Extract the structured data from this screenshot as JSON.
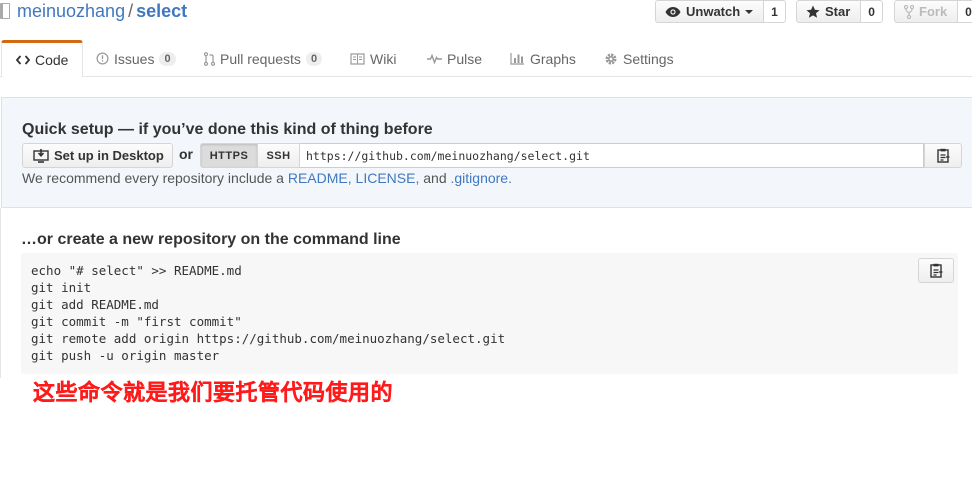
{
  "repo": {
    "owner": "meinuozhang",
    "separator": "/",
    "name": "select"
  },
  "actions": {
    "watch": {
      "label": "Unwatch",
      "count": "1"
    },
    "star": {
      "label": "Star",
      "count": "0"
    },
    "fork": {
      "label": "Fork",
      "count": "0"
    }
  },
  "tabs": [
    {
      "label": "Code",
      "icon": "code-icon",
      "selected": true
    },
    {
      "label": "Issues",
      "count": "0",
      "icon": "issue-icon"
    },
    {
      "label": "Pull requests",
      "count": "0",
      "icon": "pull-request-icon"
    },
    {
      "label": "Wiki",
      "icon": "book-icon"
    },
    {
      "label": "Pulse",
      "icon": "pulse-icon"
    },
    {
      "label": "Graphs",
      "icon": "graph-icon"
    },
    {
      "label": "Settings",
      "icon": "gear-icon"
    }
  ],
  "quick_setup": {
    "title": "Quick setup — if you’ve done this kind of thing before",
    "desktop_button": "Set up in Desktop",
    "or": "or",
    "https_label": "HTTPS",
    "ssh_label": "SSH",
    "clone_url": "https://github.com/meinuozhang/select.git",
    "recommend_prefix": "We recommend every repository include a",
    "readme_link": "README,",
    "license_link": "LICENSE,",
    "and": "and",
    "gitignore_link": ".gitignore."
  },
  "command_line": {
    "title": "…or create a new repository on the command line",
    "commands": [
      "echo \"# select\" >> README.md",
      "git init",
      "git add README.md",
      "git commit -m \"first commit\"",
      "git remote add origin https://github.com/meinuozhang/select.git",
      "git push -u origin master"
    ]
  },
  "annotation": "这些命令就是我们要托管代码使用的",
  "colors": {
    "link": "#4078c0",
    "tab_accent": "#d26911",
    "annotation": "#ff1b1b"
  }
}
